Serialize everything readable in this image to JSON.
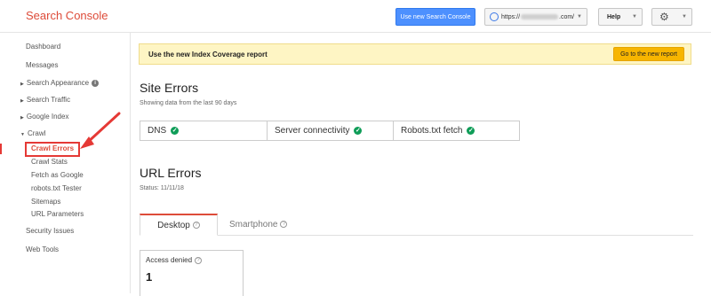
{
  "app": {
    "title": "Search Console"
  },
  "header": {
    "new_console_button": "Use new Search Console",
    "site_prefix": "https://",
    "site_suffix": ".com/",
    "help_label": "Help"
  },
  "sidebar": {
    "items": [
      {
        "label": "Dashboard"
      },
      {
        "label": "Messages"
      },
      {
        "label": "Search Appearance"
      },
      {
        "label": "Search Traffic"
      },
      {
        "label": "Google Index"
      },
      {
        "label": "Crawl"
      }
    ],
    "crawl_children": [
      {
        "label": "Crawl Errors"
      },
      {
        "label": "Crawl Stats"
      },
      {
        "label": "Fetch as Google"
      },
      {
        "label": "robots.txt Tester"
      },
      {
        "label": "Sitemaps"
      },
      {
        "label": "URL Parameters"
      }
    ],
    "bottom_items": [
      {
        "label": "Security Issues"
      },
      {
        "label": "Web Tools"
      }
    ]
  },
  "banner": {
    "text": "Use the new Index Coverage report",
    "button": "Go to the new report"
  },
  "site_errors": {
    "title": "Site Errors",
    "subtitle": "Showing data from the last 90 days",
    "items": [
      {
        "label": "DNS"
      },
      {
        "label": "Server connectivity"
      },
      {
        "label": "Robots.txt fetch"
      }
    ]
  },
  "url_errors": {
    "title": "URL Errors",
    "status": "Status: 11/11/18",
    "tabs": [
      {
        "label": "Desktop"
      },
      {
        "label": "Smartphone"
      }
    ],
    "card": {
      "label": "Access denied",
      "value": "1"
    }
  },
  "colors": {
    "brand": "#dd4b39",
    "primary_button": "#4d90fe",
    "banner_bg": "#fef5c4",
    "banner_button": "#f7b500",
    "ok": "#0f9d58",
    "highlight": "#e53935"
  }
}
